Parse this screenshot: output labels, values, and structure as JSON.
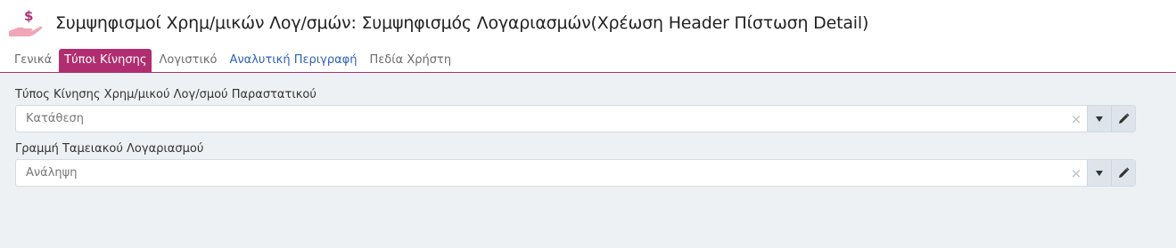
{
  "header": {
    "title": "Συμψηφισμοί Χρημ/μικών Λογ/σμών: Συμψηφισμός Λογαριασμών(Χρέωση Header Πίστωση Detail)",
    "logo_symbol": "$",
    "logo_icon": "hand-dollar-icon",
    "accent_color": "#b02e6f"
  },
  "tabs": [
    {
      "label": "Γενικά",
      "active": false
    },
    {
      "label": "Τύποι Κίνησης",
      "active": true
    },
    {
      "label": "Λογιστικό",
      "active": false
    },
    {
      "label": "Αναλυτική Περιγραφή",
      "active": false
    },
    {
      "label": "Πεδία Χρήστη",
      "active": false
    }
  ],
  "fields": [
    {
      "label": "Τύπος Κίνησης Χρημ/μικού Λογ/σμού Παραστατικού",
      "value": "Κατάθεση",
      "clear": "×"
    },
    {
      "label": "Γραμμή Ταμειακού Λογαριασμού",
      "value": "Ανάληψη",
      "clear": "×"
    }
  ]
}
